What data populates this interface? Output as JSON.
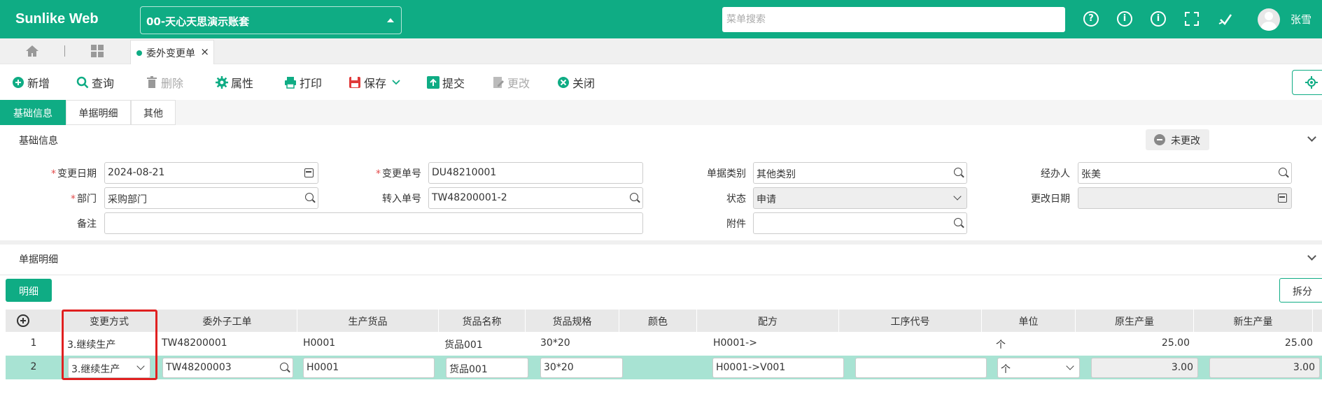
{
  "app": {
    "logo": "Sunlike Web",
    "account": "00-天心天思演示账套",
    "search_placeholder": "菜单搜索",
    "user": "张雪"
  },
  "tabs": {
    "doc_tab": "委外变更单",
    "close": "×"
  },
  "toolbar": {
    "add": "新增",
    "query": "查询",
    "delete": "删除",
    "properties": "属性",
    "print": "打印",
    "save": "保存",
    "submit": "提交",
    "modify": "更改",
    "close": "关闭"
  },
  "section_tabs": [
    "基础信息",
    "单据明细",
    "其他"
  ],
  "basic": {
    "header": "基础信息",
    "status_badge": "未更改",
    "fields": {
      "change_date": {
        "label": "变更日期",
        "value": "2024-08-21"
      },
      "change_no": {
        "label": "变更单号",
        "value": "DU48210001"
      },
      "doc_type": {
        "label": "单据类别",
        "value": "其他类别"
      },
      "handler": {
        "label": "经办人",
        "value": "张美"
      },
      "dept": {
        "label": "部门",
        "value": "采购部门"
      },
      "transfer_no": {
        "label": "转入单号",
        "value": "TW48200001-2"
      },
      "status": {
        "label": "状态",
        "value": "申请"
      },
      "modify_date": {
        "label": "更改日期",
        "value": ""
      },
      "remark": {
        "label": "备注",
        "value": ""
      },
      "attachment": {
        "label": "附件",
        "value": ""
      }
    },
    "required_mark": "*"
  },
  "detail": {
    "header": "单据明细",
    "detail_button": "明细",
    "split_button": "拆分",
    "columns": [
      "变更方式",
      "委外子工单",
      "生产货品",
      "货品名称",
      "货品规格",
      "颜色",
      "配方",
      "工序代号",
      "单位",
      "原生产量",
      "新生产量"
    ],
    "rows": [
      {
        "no": "1",
        "method": "3.继续生产",
        "sub_order": "TW48200001",
        "product": "H0001",
        "name": "货品001",
        "spec": "30*20",
        "color": "",
        "formula": "H0001->",
        "process": "",
        "unit": "个",
        "orig_qty": "25.00",
        "new_qty": "25.00"
      },
      {
        "no": "2",
        "method": "3.继续生产",
        "sub_order": "TW48200003",
        "product": "H0001",
        "name": "货品001",
        "spec": "30*20",
        "color": "",
        "formula": "H0001->V001",
        "process": "",
        "unit": "个",
        "orig_qty": "3.00",
        "new_qty": "3.00"
      }
    ]
  },
  "colors": {
    "accent": "#0fac84",
    "selected_row": "#a8e3d3",
    "highlight_box": "#e02020"
  }
}
